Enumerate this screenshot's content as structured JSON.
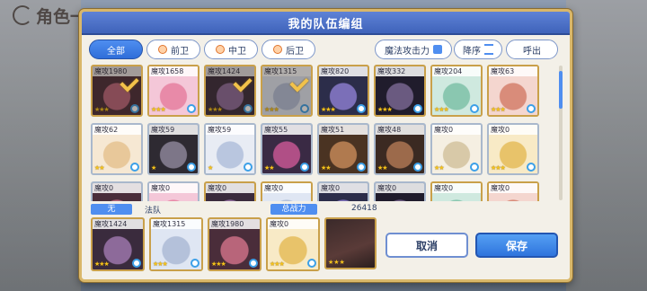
{
  "background": {
    "title": "角色一"
  },
  "dialog": {
    "title": "我的队伍编组",
    "tabs": [
      {
        "label": "全部",
        "active": true
      },
      {
        "label": "前卫",
        "active": false
      },
      {
        "label": "中卫",
        "active": false
      },
      {
        "label": "后卫",
        "active": false
      }
    ],
    "sort_label": "魔法攻击力",
    "order_label": "降序",
    "recall_label": "呼出",
    "accent_color": "#3f63ba"
  },
  "roster": [
    {
      "power": "魔攻1980",
      "stars": "★★★",
      "selected": true,
      "frame": "gold"
    },
    {
      "power": "魔攻1658",
      "stars": "★★★",
      "selected": false,
      "frame": "gold"
    },
    {
      "power": "魔攻1424",
      "stars": "★★★",
      "selected": true,
      "frame": "gold"
    },
    {
      "power": "魔攻1315",
      "stars": "★★★",
      "selected": true,
      "frame": "gold"
    },
    {
      "power": "魔攻820",
      "stars": "★★★",
      "selected": false,
      "frame": "gold"
    },
    {
      "power": "魔攻332",
      "stars": "★★★",
      "selected": false,
      "frame": "gold"
    },
    {
      "power": "魔攻204",
      "stars": "★★★",
      "selected": false,
      "frame": "gold"
    },
    {
      "power": "魔攻63",
      "stars": "★★★",
      "selected": false,
      "frame": "gold"
    },
    {
      "power": "魔攻62",
      "stars": "★★",
      "selected": false,
      "frame": "silver"
    },
    {
      "power": "魔攻59",
      "stars": "★",
      "selected": false,
      "frame": "silver"
    },
    {
      "power": "魔攻59",
      "stars": "★",
      "selected": false,
      "frame": "silver"
    },
    {
      "power": "魔攻55",
      "stars": "★★",
      "selected": false,
      "frame": "silver"
    },
    {
      "power": "魔攻51",
      "stars": "★★",
      "selected": false,
      "frame": "silver"
    },
    {
      "power": "魔攻48",
      "stars": "★★",
      "selected": false,
      "frame": "silver"
    },
    {
      "power": "魔攻0",
      "stars": "★★",
      "selected": false,
      "frame": "silver"
    },
    {
      "power": "魔攻0",
      "stars": "★★★",
      "selected": false,
      "frame": "silver"
    },
    {
      "power": "魔攻0",
      "stars": "",
      "selected": false,
      "frame": "silver"
    },
    {
      "power": "魔攻0",
      "stars": "",
      "selected": false,
      "frame": "silver"
    },
    {
      "power": "魔攻0",
      "stars": "",
      "selected": false,
      "frame": "gold"
    },
    {
      "power": "魔攻0",
      "stars": "",
      "selected": false,
      "frame": "gold"
    },
    {
      "power": "魔攻0",
      "stars": "",
      "selected": false,
      "frame": "silver"
    },
    {
      "power": "魔攻0",
      "stars": "",
      "selected": false,
      "frame": "silver"
    },
    {
      "power": "魔攻0",
      "stars": "",
      "selected": false,
      "frame": "gold"
    },
    {
      "power": "魔攻0",
      "stars": "",
      "selected": false,
      "frame": "gold"
    }
  ],
  "party_info": {
    "type_tag": "无",
    "party_name": "法队",
    "total_power_label": "总战力",
    "total_power_value": "26418"
  },
  "party": [
    {
      "power": "魔攻1424",
      "stars": "★★★"
    },
    {
      "power": "魔攻1315",
      "stars": "★★★"
    },
    {
      "power": "魔攻1980",
      "stars": "★★★"
    },
    {
      "power": "魔攻0",
      "stars": "★★★"
    },
    {
      "power": "",
      "stars": "★★★"
    }
  ],
  "buttons": {
    "cancel": "取消",
    "save": "保存"
  }
}
